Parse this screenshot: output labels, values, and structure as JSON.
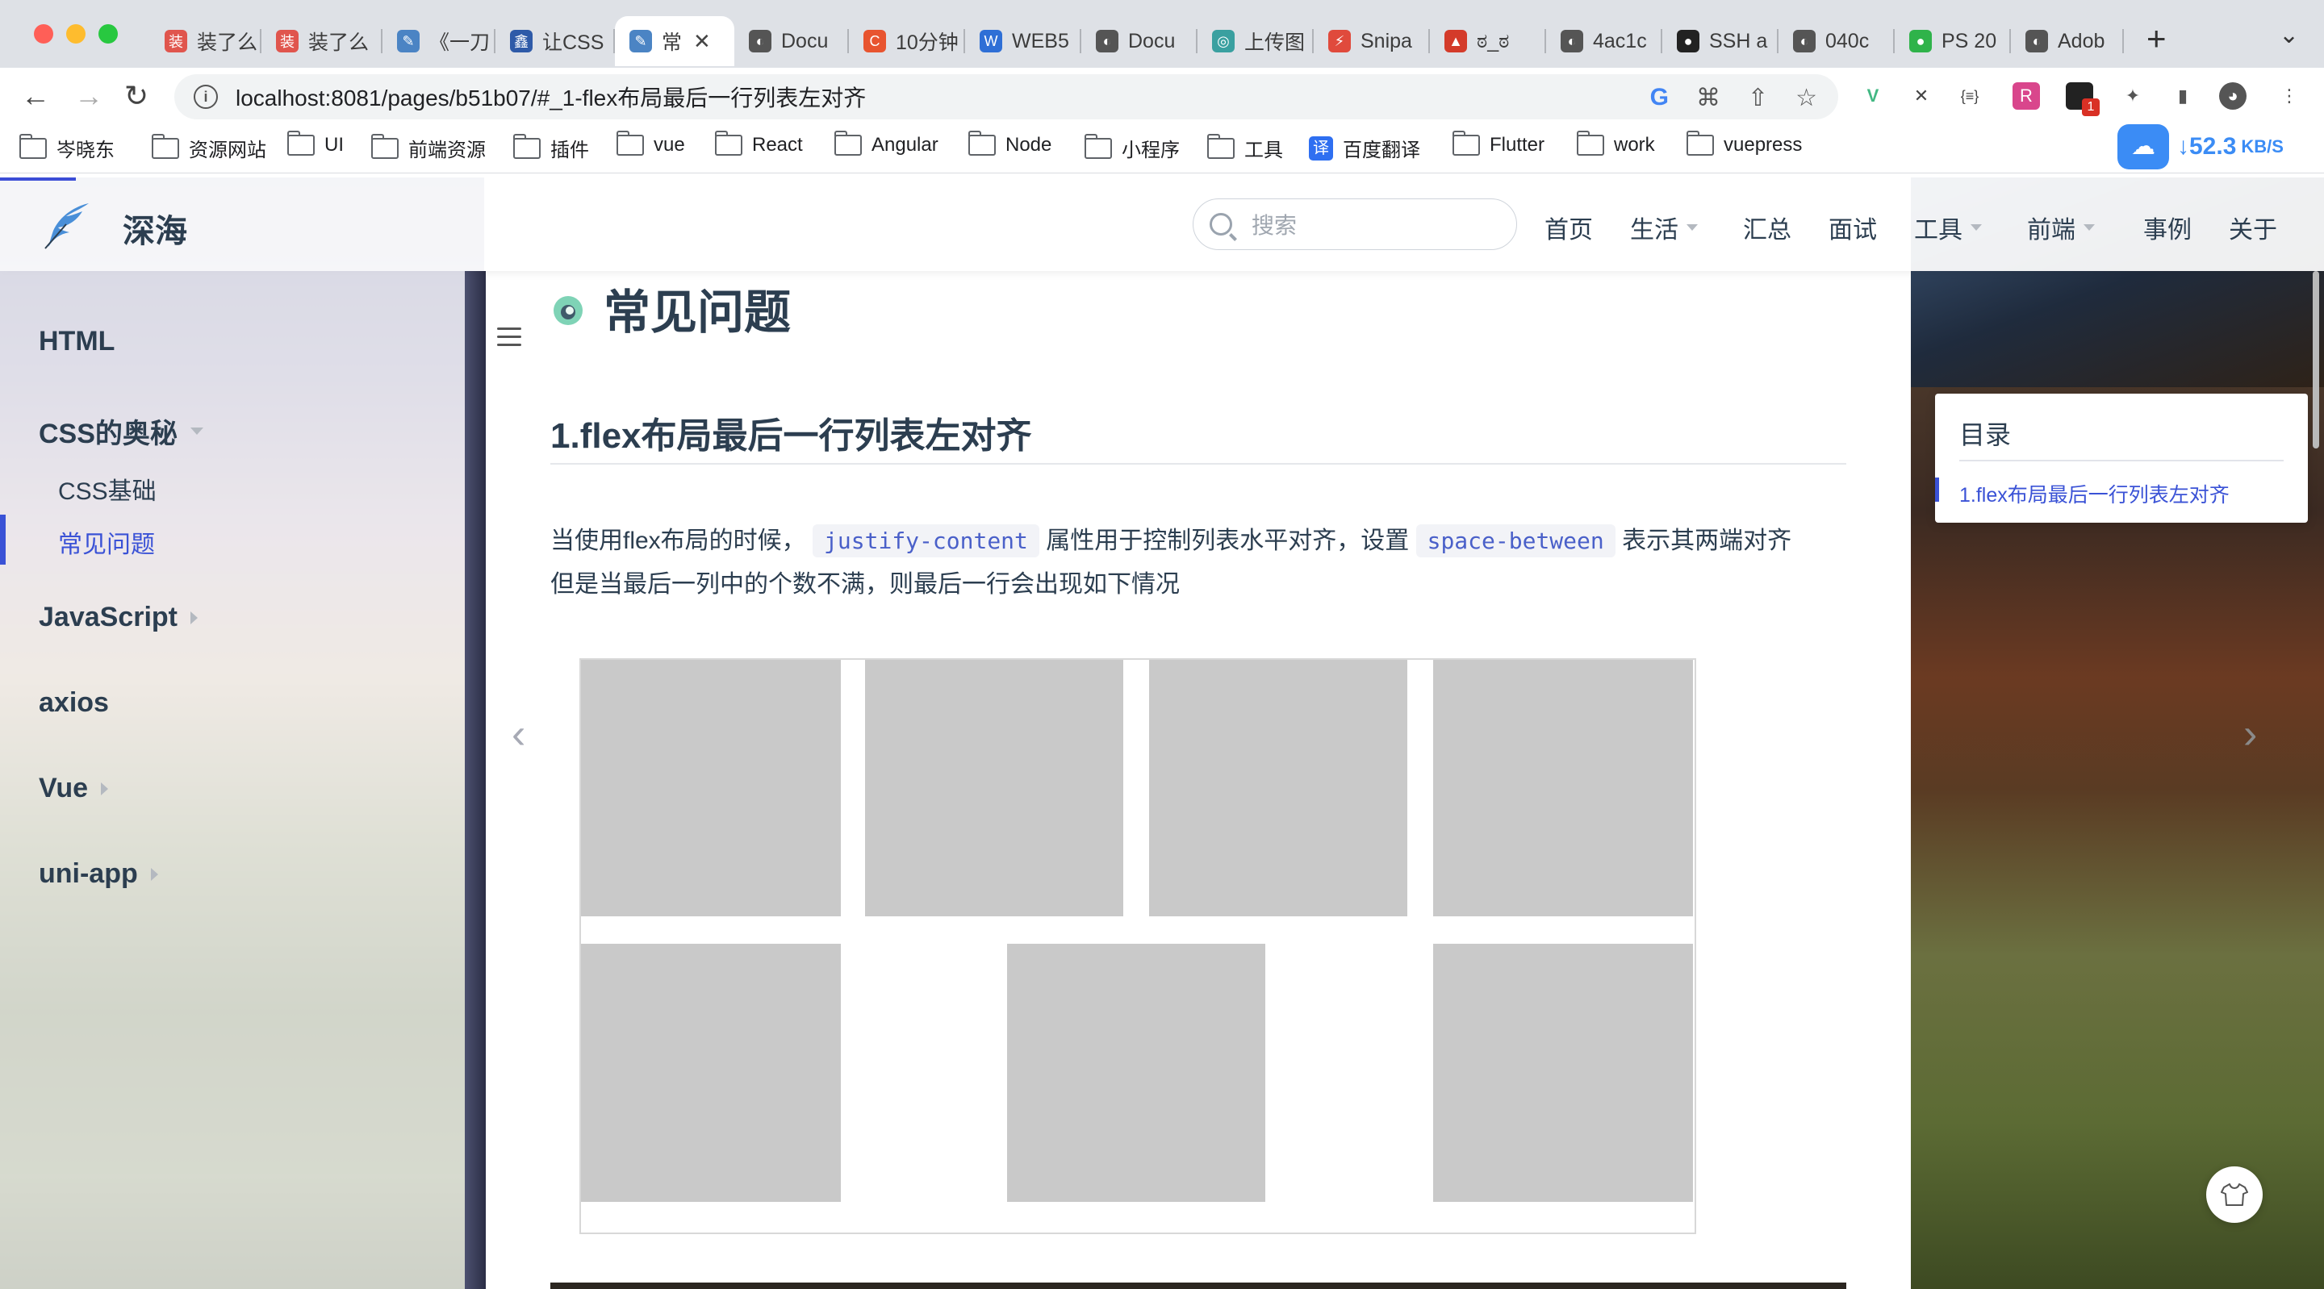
{
  "browser": {
    "tabs": [
      {
        "label": "装了么",
        "favicon_color": "#e0554d"
      },
      {
        "label": "装了么",
        "favicon_color": "#e0554d"
      },
      {
        "label": "《一刀",
        "favicon_color": "#4b84c4"
      },
      {
        "label": "让CSS",
        "favicon_color": "#2e5aa8"
      },
      {
        "label": "常",
        "favicon_color": "#4b84c4",
        "active": true
      },
      {
        "label": "Docu",
        "favicon_color": "#555555"
      },
      {
        "label": "10分钟",
        "favicon_color": "#e8542f"
      },
      {
        "label": "WEB5",
        "favicon_color": "#2e6fd6"
      },
      {
        "label": "Docu",
        "favicon_color": "#555555"
      },
      {
        "label": "上传图",
        "favicon_color": "#3aa0a0"
      },
      {
        "label": "Snipa",
        "favicon_color": "#e04a3c"
      },
      {
        "label": "ಠ_ಠ",
        "favicon_color": "#d43b2a"
      },
      {
        "label": "4ac1c",
        "favicon_color": "#555555"
      },
      {
        "label": "SSH a",
        "favicon_color": "#222222"
      },
      {
        "label": "040c",
        "favicon_color": "#555555"
      },
      {
        "label": "PS 20",
        "favicon_color": "#2fb34a"
      },
      {
        "label": "Adob",
        "favicon_color": "#555555"
      }
    ],
    "url": "localhost:8081/pages/b51b07/#_1-flex布局最后一行列表左对齐",
    "bookmarks": [
      "岑晓东",
      "资源网站",
      "UI",
      "前端资源",
      "插件",
      "vue",
      "React",
      "Angular",
      "Node",
      "小程序",
      "工具",
      "百度翻译",
      "Flutter",
      "work",
      "vuepress"
    ],
    "translate_badge": "译",
    "ext_badge": "1",
    "speed": {
      "value": "52.3",
      "unit": "KB/S"
    }
  },
  "site": {
    "name": "深海",
    "search_placeholder": "搜索",
    "nav": [
      {
        "label": "首页",
        "dropdown": false
      },
      {
        "label": "生活",
        "dropdown": true
      },
      {
        "label": "汇总",
        "dropdown": false
      },
      {
        "label": "面试",
        "dropdown": false
      },
      {
        "label": "工具",
        "dropdown": true
      },
      {
        "label": "前端",
        "dropdown": true
      },
      {
        "label": "事例",
        "dropdown": false
      },
      {
        "label": "关于",
        "dropdown": false
      }
    ]
  },
  "sidebar": {
    "items": [
      {
        "label": "HTML",
        "type": "group"
      },
      {
        "label": "CSS的奥秘",
        "type": "group",
        "expanded": true
      },
      {
        "label": "CSS基础",
        "type": "sub"
      },
      {
        "label": "常见问题",
        "type": "sub",
        "active": true
      },
      {
        "label": "JavaScript",
        "type": "group",
        "collapsed": true
      },
      {
        "label": "axios",
        "type": "group"
      },
      {
        "label": "Vue",
        "type": "group",
        "collapsed": true
      },
      {
        "label": "uni-app",
        "type": "group",
        "collapsed": true
      }
    ]
  },
  "article": {
    "title": "常见问题",
    "heading": "1.flex布局最后一行列表左对齐",
    "para_1": "当使用flex布局的时候，",
    "code_1": "justify-content",
    "para_2": "属性用于控制列表水平对齐，设置",
    "code_2": "space-between",
    "para_3": "表示其两端对齐",
    "para_4": "但是当最后一列中的个数不满，则最后一行会出现如下情况"
  },
  "toc": {
    "title": "目录",
    "items": [
      "1.flex布局最后一行列表左对齐"
    ]
  },
  "colors": {
    "accent": "#3a52d6",
    "code_bg": "#f2f3f7",
    "demo_box": "#c9c9c9"
  }
}
